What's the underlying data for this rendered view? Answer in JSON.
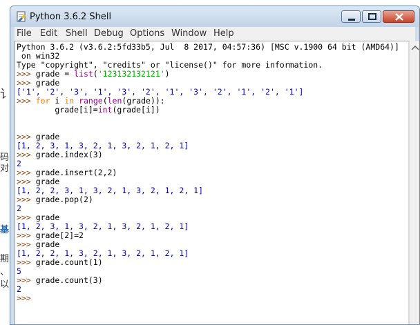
{
  "window": {
    "title": "Python 3.6.2 Shell"
  },
  "menu": [
    "File",
    "Edit",
    "Shell",
    "Debug",
    "Options",
    "Window",
    "Help"
  ],
  "background_glyphs": [
    "讠",
    "码",
    "对",
    "基",
    "期",
    "、",
    "以"
  ],
  "shell": {
    "banner1": "Python 3.6.2 (v3.6.2:5fd33b5, Jul  8 2017, 04:57:36) [MSC v.1900 64 bit (AMD64)]",
    "banner2": " on win32",
    "banner3": "Type \"copyright\", \"credits\" or \"license()\" for more information.",
    "prompt": ">>> ",
    "l1_a": "grade = ",
    "l1_bi": "list",
    "l1_b": "(",
    "l1_str": "'123132132121'",
    "l1_c": ")",
    "l2": "grade",
    "l3": "['1', '2', '3', '1', '3', '2', '1', '3', '2', '1', '2', '1']",
    "l4_kw1": "for",
    "l4_a": " i ",
    "l4_kw2": "in",
    "l4_b": " ",
    "l4_bi1": "range",
    "l4_c": "(",
    "l4_bi2": "len",
    "l4_d": "(grade)):",
    "l5_a": "        grade[i]=",
    "l5_bi": "int",
    "l5_b": "(grade[i])",
    "l6": "grade",
    "l7": "[1, 2, 3, 1, 3, 2, 1, 3, 2, 1, 2, 1]",
    "l8": "grade.index(3)",
    "l9": "2",
    "l10": "grade.insert(2,2)",
    "l11": "grade",
    "l12": "[1, 2, 2, 3, 1, 3, 2, 1, 3, 2, 1, 2, 1]",
    "l13": "grade.pop(2)",
    "l14": "2",
    "l15": "grade",
    "l16": "[1, 2, 3, 1, 3, 2, 1, 3, 2, 1, 2, 1]",
    "l17": "grade[2]=2",
    "l18": "grade",
    "l19": "[1, 2, 2, 1, 3, 2, 1, 3, 2, 1, 2, 1]",
    "l20": "grade.count(1)",
    "l21": "5",
    "l22": "grade.count(3)",
    "l23": "2"
  }
}
